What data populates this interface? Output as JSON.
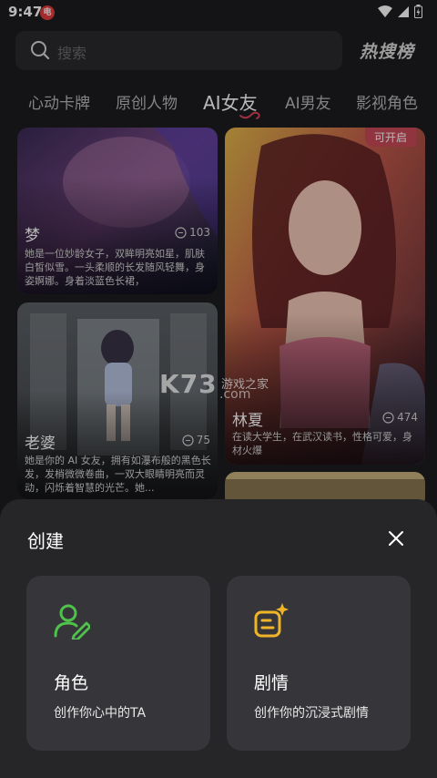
{
  "status": {
    "time": "9:47",
    "app_badge": "电"
  },
  "search": {
    "placeholder": "搜索",
    "hot_list_label": "热搜榜"
  },
  "tabs": [
    {
      "label": "心动卡牌"
    },
    {
      "label": "原创人物"
    },
    {
      "label": "AI女友",
      "active": true
    },
    {
      "label": "AI男友"
    },
    {
      "label": "影视角色"
    }
  ],
  "cards": [
    {
      "title": "梦",
      "count": "103",
      "desc": "她是一位妙龄女子，双眸明亮如星，肌肤白皙似雪。一头柔顺的长发随风轻舞，身姿婀娜。身着淡蓝色长裙，"
    },
    {
      "title": "林夏",
      "count": "474",
      "badge": "可开启",
      "desc": "在读大学生，在武汉读书，性格可爱，身材火爆"
    },
    {
      "title": "老婆",
      "count": "75",
      "desc": "她是你的 AI 女友，拥有如瀑布般的黑色长发，发梢微微卷曲，一双大眼睛明亮而灵动，闪烁着智慧的光芒。她..."
    }
  ],
  "watermark": {
    "brand": "K73",
    "site": "游戏之家",
    "domain": ".com"
  },
  "sheet": {
    "title": "创建",
    "options": [
      {
        "title": "角色",
        "subtitle": "创作你心中的TA",
        "icon": "person-edit-icon",
        "color": "#4ec24a"
      },
      {
        "title": "剧情",
        "subtitle": "创作你的沉浸式剧情",
        "icon": "story-sparkle-icon",
        "color": "#f0b429"
      }
    ]
  }
}
